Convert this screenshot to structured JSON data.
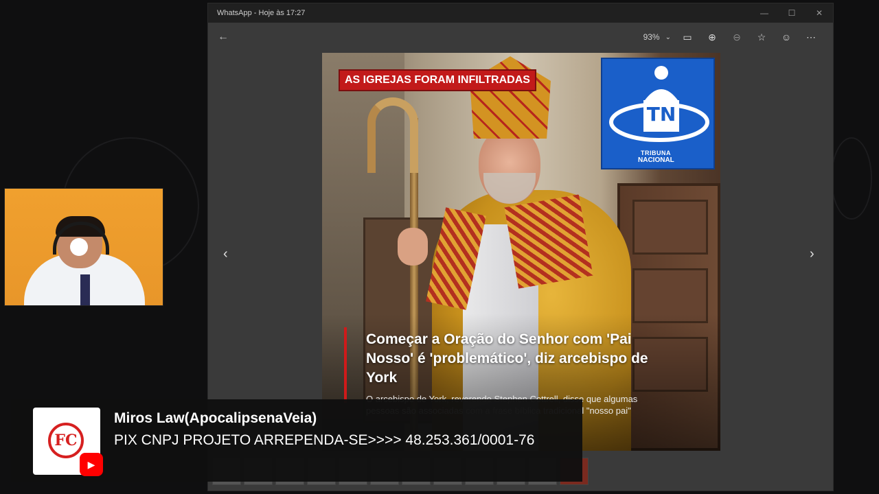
{
  "window": {
    "title": "WhatsApp - Hoje às 17:27",
    "controls": [
      "minimize-icon",
      "maximize-icon",
      "close-icon"
    ]
  },
  "toolbar": {
    "back_icon": "back-arrow-icon",
    "zoom": "93%",
    "buttons": [
      "fit-to-window-icon",
      "zoom-in-icon",
      "zoom-out-icon",
      "favorite-star-icon",
      "emoji-icon",
      "more-options-icon"
    ]
  },
  "image": {
    "badge": "AS IGREJAS FORAM INFILTRADAS",
    "logo": {
      "initials": "TN",
      "name_line1": "TRIBUNA",
      "name_line2": "NACIONAL"
    },
    "headline": "Começar a Oração do Senhor com 'Pai Nosso' é 'problemático', diz arcebispo de York",
    "body": "O arcebispo de York, reverendo Stephen Cottrell, disse que algumas pessoas são associadas com a frase bíblica tradicional \"nosso pai\""
  },
  "navigation": {
    "prev_icon": "chevron-left-icon",
    "next_icon": "chevron-right-icon"
  },
  "banner": {
    "channel_name": "Miros Law(ApocalipsenaVeia)",
    "pix_line": "PIX CNPJ PROJETO ARREPENDA-SE>>>> 48.253.361/0001-76",
    "logo_mark": "FC",
    "youtube_icon": "youtube-icon"
  },
  "colors": {
    "badge_red": "#c21a1a",
    "logo_blue": "#1a5fc9",
    "webcam_bg": "#f0a02e",
    "banner_bg": "#101010"
  }
}
